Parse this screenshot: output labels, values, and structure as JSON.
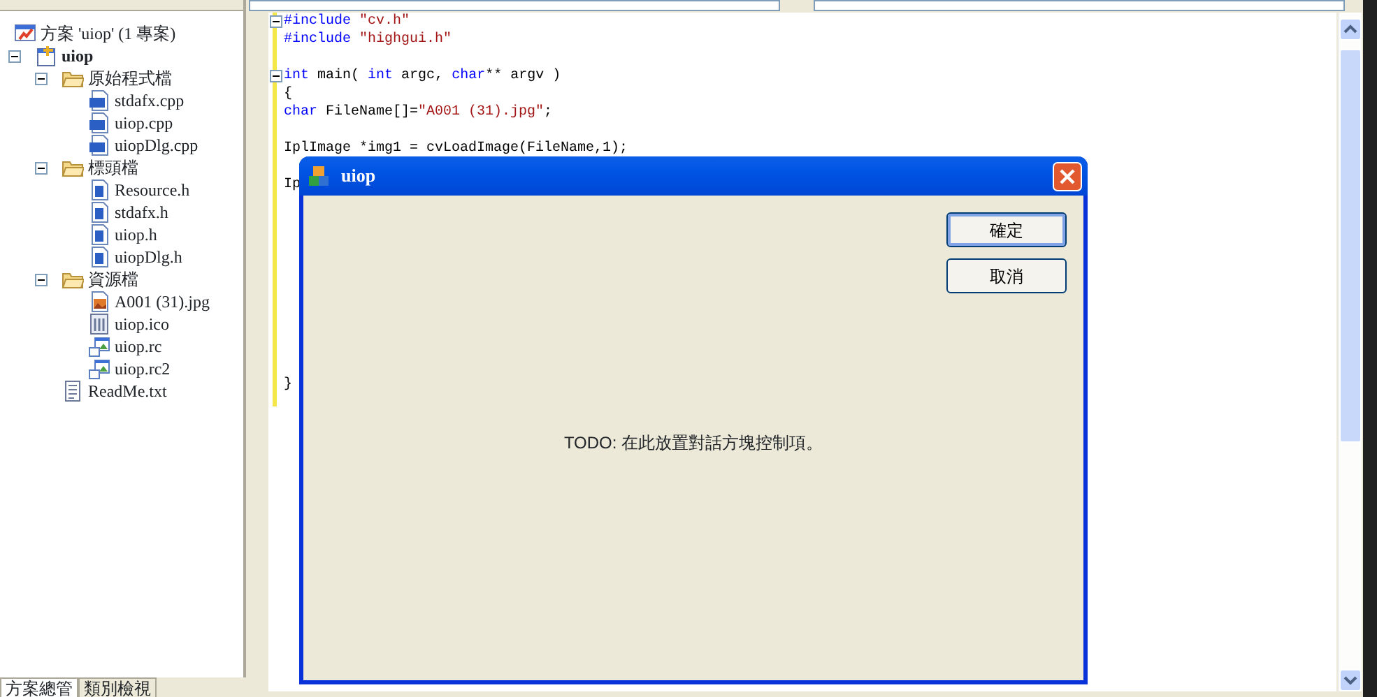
{
  "solution_explorer": {
    "tree": [
      {
        "kind": "solution",
        "label": "方案 'uiop' (1 專案)",
        "children": [
          {
            "kind": "project",
            "label": "uiop",
            "expanded": true,
            "children": [
              {
                "kind": "folder",
                "label": "原始程式檔",
                "expanded": true,
                "children": [
                  {
                    "kind": "cpp",
                    "label": "stdafx.cpp"
                  },
                  {
                    "kind": "cpp",
                    "label": "uiop.cpp"
                  },
                  {
                    "kind": "cpp",
                    "label": "uiopDlg.cpp"
                  }
                ]
              },
              {
                "kind": "folder",
                "label": "標頭檔",
                "expanded": true,
                "children": [
                  {
                    "kind": "h",
                    "label": "Resource.h"
                  },
                  {
                    "kind": "h",
                    "label": "stdafx.h"
                  },
                  {
                    "kind": "h",
                    "label": "uiop.h"
                  },
                  {
                    "kind": "h",
                    "label": "uiopDlg.h"
                  }
                ]
              },
              {
                "kind": "folder",
                "label": "資源檔",
                "expanded": true,
                "children": [
                  {
                    "kind": "image",
                    "label": "A001 (31).jpg"
                  },
                  {
                    "kind": "icon",
                    "label": "uiop.ico"
                  },
                  {
                    "kind": "rc",
                    "label": "uiop.rc"
                  },
                  {
                    "kind": "rc",
                    "label": "uiop.rc2"
                  }
                ]
              },
              {
                "kind": "text",
                "label": "ReadMe.txt"
              }
            ]
          }
        ]
      }
    ],
    "tabs": [
      {
        "label": "方案總管",
        "selected": true
      },
      {
        "label": "類別檢視",
        "selected": false
      }
    ]
  },
  "editor": {
    "lines": [
      {
        "collapsible": true,
        "segments": [
          {
            "kind": "keyword",
            "text": "#include "
          },
          {
            "kind": "string",
            "text": "\"cv.h\""
          }
        ]
      },
      {
        "segments": [
          {
            "kind": "keyword",
            "text": "#include "
          },
          {
            "kind": "string",
            "text": "\"highgui.h\""
          }
        ]
      },
      {
        "blank": true
      },
      {
        "collapsible": true,
        "segments": [
          {
            "kind": "keyword",
            "text": "int"
          },
          {
            "kind": "plain",
            "text": " main( "
          },
          {
            "kind": "keyword",
            "text": "int"
          },
          {
            "kind": "plain",
            "text": " argc, "
          },
          {
            "kind": "keyword",
            "text": "char"
          },
          {
            "kind": "plain",
            "text": "** argv )"
          }
        ]
      },
      {
        "segments": [
          {
            "kind": "plain",
            "text": "{"
          }
        ]
      },
      {
        "segments": [
          {
            "kind": "keyword",
            "text": "char"
          },
          {
            "kind": "plain",
            "text": " FileName[]="
          },
          {
            "kind": "string",
            "text": "\"A001 (31).jpg\""
          },
          {
            "kind": "plain",
            "text": ";"
          }
        ]
      },
      {
        "blank": true
      },
      {
        "segments": [
          {
            "kind": "plain",
            "text": "IplImage *img1 = cvLoadImage(FileName,1);"
          }
        ]
      },
      {
        "blank": true
      },
      {
        "segments": [
          {
            "kind": "plain",
            "text": "Ip"
          }
        ]
      },
      {
        "blank": true
      },
      {
        "blank": true
      },
      {
        "blank": true
      },
      {
        "blank": true
      },
      {
        "blank": true
      },
      {
        "blank": true
      },
      {
        "blank": true
      },
      {
        "blank": true
      },
      {
        "blank": true
      },
      {
        "blank": true
      },
      {
        "segments": [
          {
            "kind": "plain",
            "text": "}"
          }
        ]
      }
    ]
  },
  "dialog": {
    "title": "uiop",
    "message": "TODO: 在此放置對話方塊控制項。",
    "buttons": [
      {
        "label": "確定",
        "default": true
      },
      {
        "label": "取消",
        "default": false
      }
    ]
  }
}
